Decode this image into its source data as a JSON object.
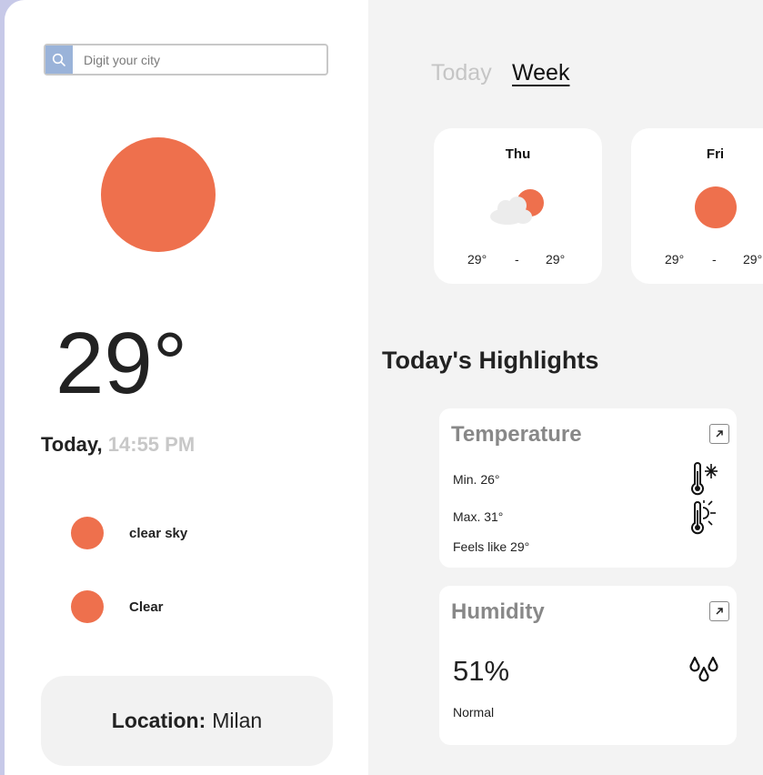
{
  "search": {
    "placeholder": "Digit your city",
    "icon": "search-icon"
  },
  "current": {
    "temperature": "29°",
    "day_label": "Today,",
    "time": "14:55 PM",
    "icon_color": "#ee704d",
    "conditions": [
      {
        "label": "clear sky",
        "icon": "sun-dot-icon"
      },
      {
        "label": "Clear",
        "icon": "sun-dot-icon"
      }
    ],
    "location_label": "Location:",
    "location": "Milan"
  },
  "tabs": [
    {
      "label": "Today",
      "active": false
    },
    {
      "label": "Week",
      "active": true
    }
  ],
  "week": [
    {
      "day": "Thu",
      "icon": "partly-cloudy-icon",
      "min": "29°",
      "sep": "-",
      "max": "29°"
    },
    {
      "day": "Fri",
      "icon": "sun-icon",
      "min": "29°",
      "sep": "-",
      "max": "29°"
    }
  ],
  "highlights": {
    "title": "Today's Highlights",
    "temperature": {
      "title": "Temperature",
      "min_label": "Min.",
      "min": "26°",
      "max_label": "Max.",
      "max": "31°",
      "feels_label": "Feels like",
      "feels": "29°"
    },
    "humidity": {
      "title": "Humidity",
      "value": "51%",
      "status": "Normal"
    }
  },
  "colors": {
    "accent": "#ee704d",
    "search_button": "#9ab3d9",
    "panel": "#f3f3f3"
  }
}
